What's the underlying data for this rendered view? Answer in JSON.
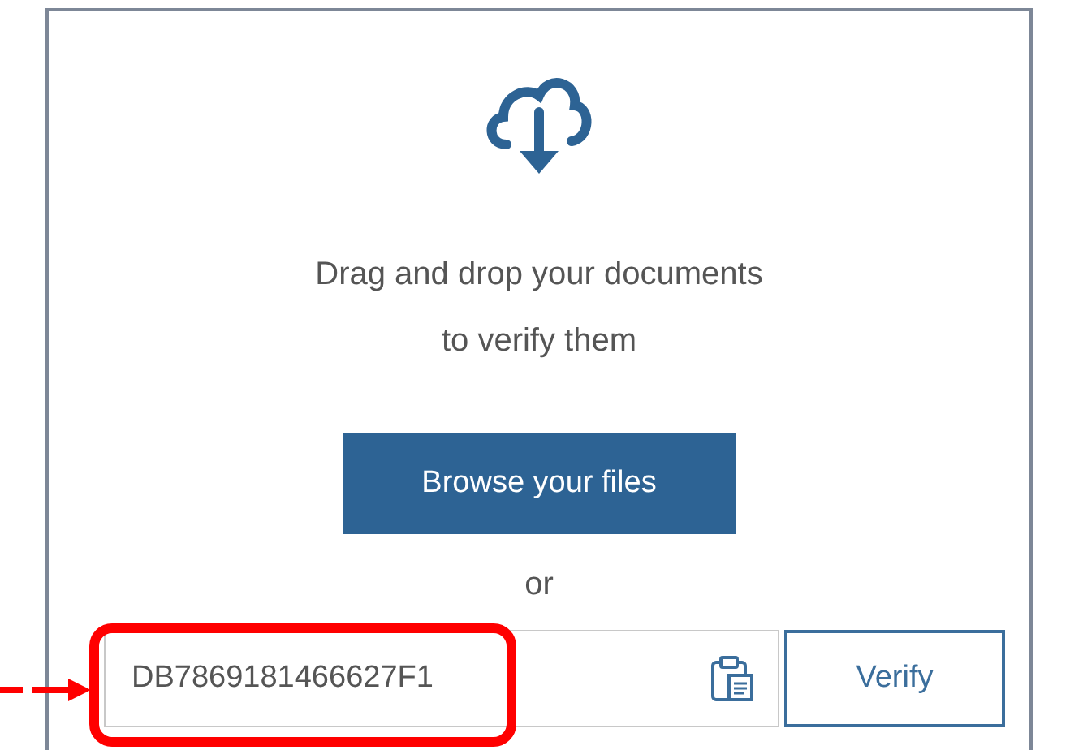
{
  "upload": {
    "prompt_lines": [
      "Drag and drop your documents",
      "to verify them"
    ],
    "browse_button": "Browse your files",
    "separator": "or",
    "code_field": {
      "value": "DB7869181466627F1"
    },
    "verify_button": "Verify"
  },
  "annotation": {
    "highlighted": true
  }
}
